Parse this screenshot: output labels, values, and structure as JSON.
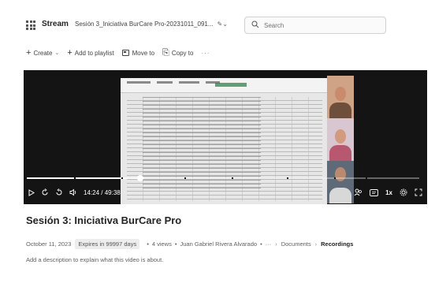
{
  "header": {
    "app_name": "Stream",
    "file_title": "Sesión 3_Iniciativa BurCare Pro-20231011_091...",
    "edit_glyph": "✎",
    "edit_chevron": "⌄",
    "search_placeholder": "Search"
  },
  "toolbar": {
    "create_label": "Create",
    "add_to_playlist_label": "Add to playlist",
    "move_to_label": "Move to",
    "copy_to_label": "Copy to",
    "more_label": "···"
  },
  "player": {
    "current_time": "14:24",
    "duration": "49:38",
    "time_separator": " / ",
    "speed_label": "1x",
    "progress_fraction": 0.29
  },
  "video": {
    "title": "Sesión 3: Iniciativa BurCare Pro",
    "date": "October 11, 2023",
    "expiry": "Expires in 99997 days",
    "views": "4 views",
    "owner": "Juan Gabriel Rivera Alvarado",
    "breadcrumb_more": "···",
    "breadcrumb_documents": "Documents",
    "breadcrumb_recordings": "Recordings",
    "description_placeholder": "Add a description to explain what this video is about."
  },
  "icons": {
    "waffle": "waffle-icon",
    "search": "search-icon",
    "plus": "plus-icon",
    "folder_move": "move-icon",
    "copy": "copy-icon",
    "play": "play-icon",
    "rewind": "rewind-10-icon",
    "forward": "forward-10-icon",
    "volume": "volume-icon",
    "captions": "captions-icon",
    "settings": "settings-icon",
    "fullscreen": "fullscreen-icon"
  }
}
